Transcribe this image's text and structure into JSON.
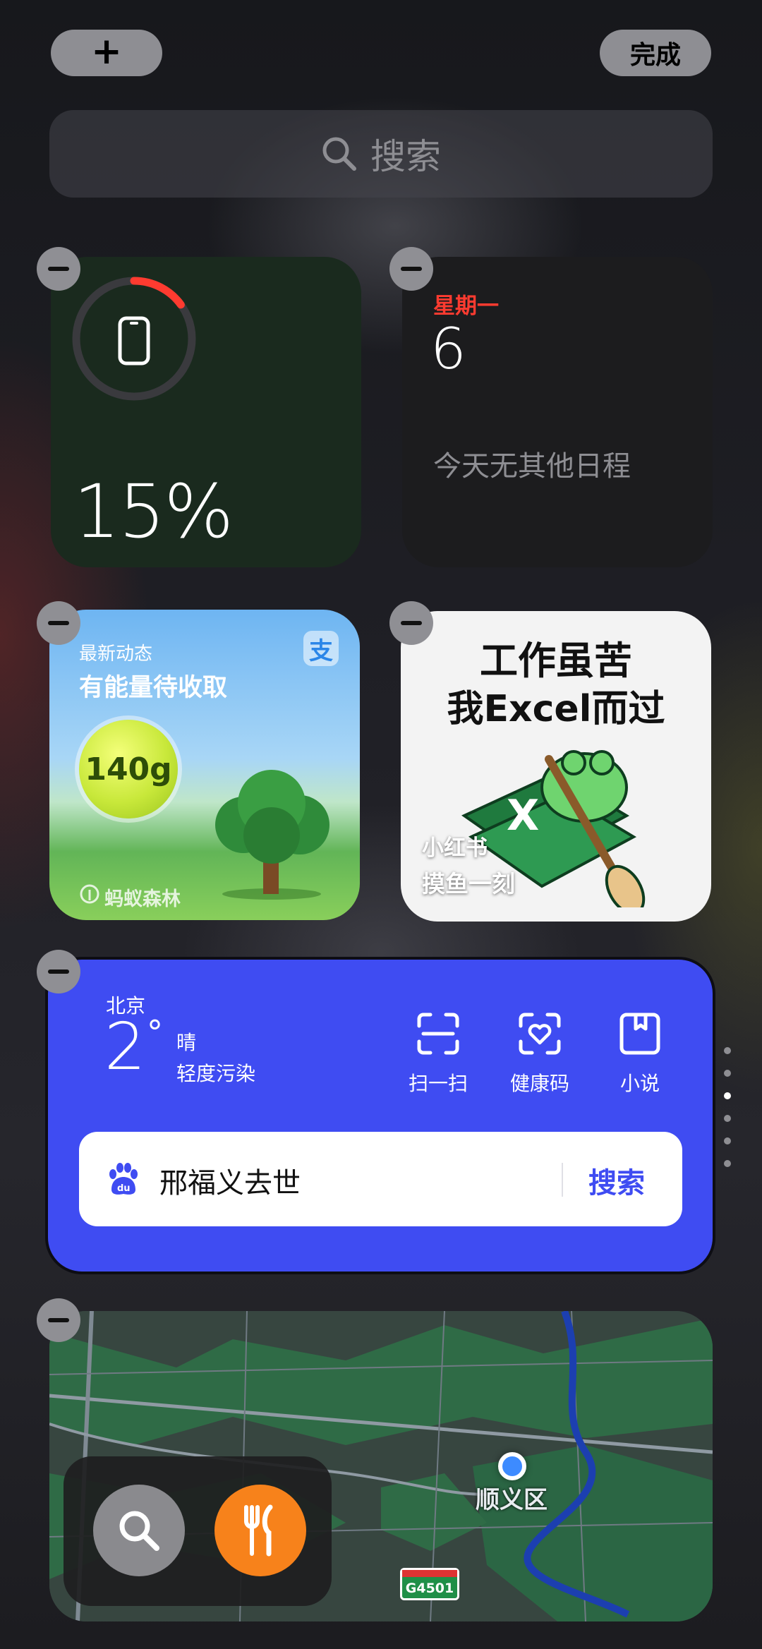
{
  "top_bar": {
    "add_label": "+",
    "done_label": "完成"
  },
  "search": {
    "placeholder": "搜索"
  },
  "battery_widget": {
    "level": 0.15,
    "level_text": "15%"
  },
  "calendar_widget": {
    "weekday": "星期一",
    "day": "6",
    "events_text": "今天无其他日程"
  },
  "alipay_widget": {
    "subtitle": "最新动态",
    "title": "有能量待收取",
    "energy": "140g",
    "app_name": "蚂蚁森林",
    "icon": "alipay-icon"
  },
  "xhs_widget": {
    "headline_line1": "工作虽苦",
    "headline_line2": "我Excel而过",
    "app_name": "小红书",
    "caption": "摸鱼一刻"
  },
  "baidu_widget": {
    "city": "北京",
    "temperature": "2",
    "degree": "°",
    "condition": "晴",
    "air_quality": "轻度污染",
    "shortcuts": [
      {
        "label": "扫一扫",
        "icon": "scan-icon"
      },
      {
        "label": "健康码",
        "icon": "health-code-icon"
      },
      {
        "label": "小说",
        "icon": "book-icon"
      }
    ],
    "search_query": "邢福义去世",
    "search_button": "搜索",
    "accent": "#3f4cf2"
  },
  "map_widget": {
    "place_label": "顺义区",
    "road_badge": "G4501",
    "buttons": [
      {
        "name": "map-search-button",
        "icon": "search-icon"
      },
      {
        "name": "map-food-button",
        "icon": "fork-knife-icon"
      }
    ]
  },
  "page_indicator": {
    "count": 6,
    "active_index": 1
  }
}
